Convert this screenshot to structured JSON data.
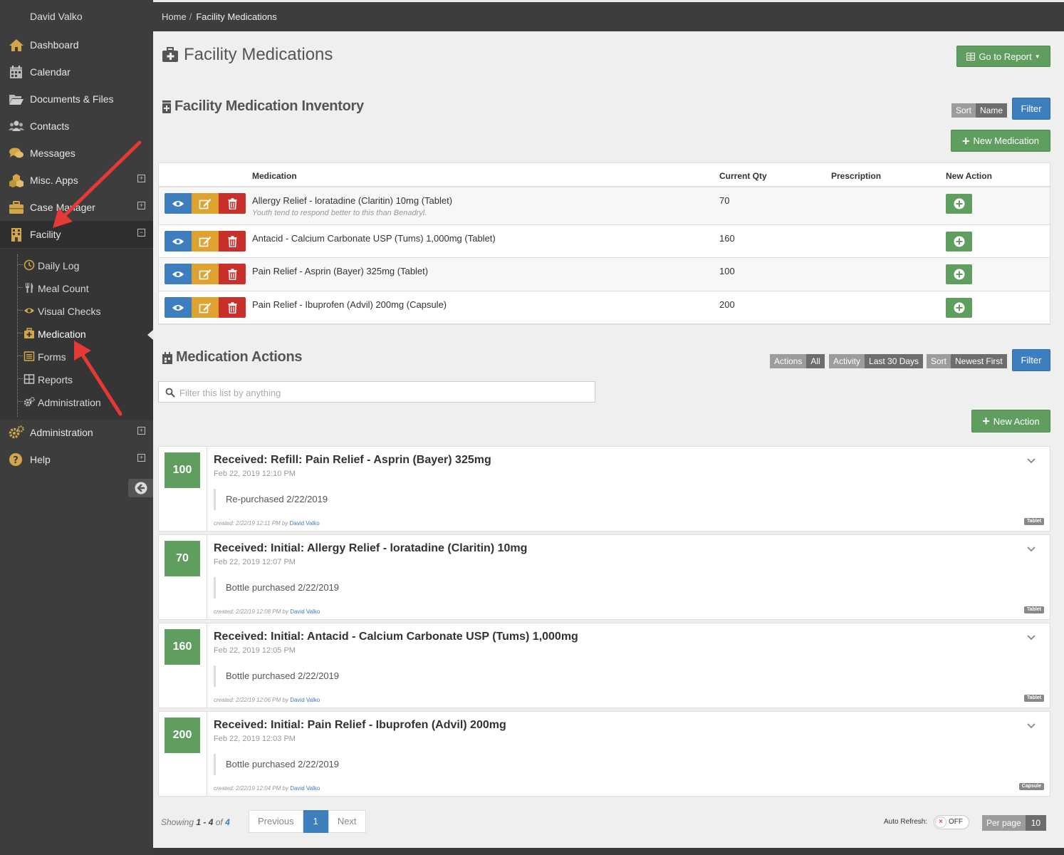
{
  "sidebar": {
    "user_name": "David Valko",
    "items": [
      {
        "label": "Dashboard",
        "icon": "home-icon"
      },
      {
        "label": "Calendar",
        "icon": "calendar-icon"
      },
      {
        "label": "Documents & Files",
        "icon": "folder-open-icon"
      },
      {
        "label": "Contacts",
        "icon": "users-icon"
      },
      {
        "label": "Messages",
        "icon": "comments-icon"
      },
      {
        "label": "Misc. Apps",
        "icon": "cubes-icon"
      },
      {
        "label": "Case Manager",
        "icon": "briefcase-icon"
      },
      {
        "label": "Facility",
        "icon": "building-icon"
      },
      {
        "label": "Administration",
        "icon": "cogs-icon"
      },
      {
        "label": "Help",
        "icon": "question-circle-icon"
      }
    ],
    "expand_plus": "+",
    "expand_minus": "−",
    "sub_items": [
      {
        "label": "Daily Log",
        "icon": "clock-icon"
      },
      {
        "label": "Meal Count",
        "icon": "cutlery-icon"
      },
      {
        "label": "Visual Checks",
        "icon": "eye-icon"
      },
      {
        "label": "Medication",
        "icon": "medkit-icon"
      },
      {
        "label": "Forms",
        "icon": "list-alt-icon"
      },
      {
        "label": "Reports",
        "icon": "table-icon"
      },
      {
        "label": "Administration",
        "icon": "cogs-icon"
      }
    ]
  },
  "breadcrumb": {
    "home": "Home",
    "separator": "/",
    "current": "Facility Medications"
  },
  "page": {
    "title": "Facility Medications",
    "go_to_report": "Go to Report"
  },
  "inventory": {
    "title": "Facility Medication Inventory",
    "sort_key": "Sort",
    "sort_value": "Name",
    "filter_label": "Filter",
    "new_medication": "New Medication",
    "columns": {
      "medication": "Medication",
      "qty": "Current Qty",
      "prescription": "Prescription",
      "new_action": "New Action"
    },
    "rows": [
      {
        "name": "Allergy Relief - loratadine (Claritin) 10mg (Tablet)",
        "note": "Youth tend to respond better to this than Benadryl.",
        "qty": "70",
        "prescription": ""
      },
      {
        "name": "Antacid - Calcium Carbonate USP (Tums) 1,000mg (Tablet)",
        "note": "",
        "qty": "160",
        "prescription": ""
      },
      {
        "name": "Pain Relief - Asprin (Bayer) 325mg (Tablet)",
        "note": "",
        "qty": "100",
        "prescription": ""
      },
      {
        "name": "Pain Relief - Ibuprofen (Advil) 200mg (Capsule)",
        "note": "",
        "qty": "200",
        "prescription": ""
      }
    ]
  },
  "actions": {
    "title": "Medication Actions",
    "filters": [
      {
        "key": "Actions",
        "value": "All"
      },
      {
        "key": "Activity",
        "value": "Last 30 Days"
      },
      {
        "key": "Sort",
        "value": "Newest First"
      }
    ],
    "filter_label": "Filter",
    "search_placeholder": "Filter this list by anything",
    "new_action": "New Action",
    "cards": [
      {
        "qty": "100",
        "title": "Received: Refill: Pain Relief - Asprin (Bayer) 325mg",
        "date": "Feb 22, 2019 12:10 PM",
        "note": "Re-purchased 2/22/2019",
        "created_label": "created:",
        "created": "2/22/19 12:11 PM by",
        "author": "David Valko",
        "tag": "Tablet"
      },
      {
        "qty": "70",
        "title": "Received: Initial: Allergy Relief - loratadine (Claritin) 10mg",
        "date": "Feb 22, 2019 12:07 PM",
        "note": "Bottle purchased 2/22/2019",
        "created_label": "created:",
        "created": "2/22/19 12:08 PM by",
        "author": "David Valko",
        "tag": "Tablet"
      },
      {
        "qty": "160",
        "title": "Received: Initial: Antacid - Calcium Carbonate USP (Tums) 1,000mg",
        "date": "Feb 22, 2019 12:05 PM",
        "note": "Bottle purchased 2/22/2019",
        "created_label": "created:",
        "created": "2/22/19 12:06 PM by",
        "author": "David Valko",
        "tag": "Tablet"
      },
      {
        "qty": "200",
        "title": "Received: Initial: Pain Relief - Ibuprofen (Advil) 200mg",
        "date": "Feb 22, 2019 12:03 PM",
        "note": "Bottle purchased 2/22/2019",
        "created_label": "created:",
        "created": "2/22/19 12:04 PM by",
        "author": "David Valko",
        "tag": "Capsule"
      }
    ]
  },
  "footer": {
    "showing_label": "Showing",
    "range": "1 - 4",
    "of_label": "of",
    "total": "4",
    "previous": "Previous",
    "page": "1",
    "next": "Next",
    "auto_refresh_label": "Auto Refresh:",
    "toggle_state": "OFF",
    "toggle_x": "×",
    "per_page_label": "Per page",
    "per_page_value": "10"
  },
  "colors": {
    "accent_green": "#5f9e5f",
    "accent_blue": "#3d7ebf",
    "danger_red": "#c9302c",
    "warning_orange": "#e0a22f",
    "sidebar_bg": "#3d3d3d",
    "annotation_red": "#e53935"
  }
}
